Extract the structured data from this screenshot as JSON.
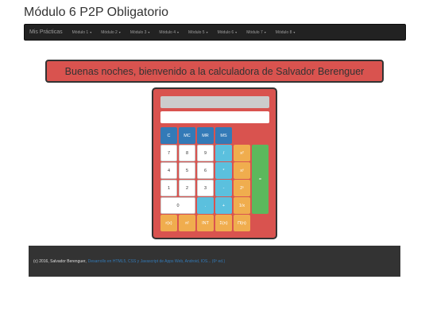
{
  "page": {
    "title": "Módulo 6 P2P Obligatorio"
  },
  "navbar": {
    "brand": "Mis Prácticas",
    "items": [
      {
        "label": "Módulo 1"
      },
      {
        "label": "Módulo 2"
      },
      {
        "label": "Módulo 3"
      },
      {
        "label": "Módulo 4"
      },
      {
        "label": "Módulo 5"
      },
      {
        "label": "Módulo 6"
      },
      {
        "label": "Módulo 7"
      },
      {
        "label": "Módulo 8"
      }
    ],
    "caret": "▾"
  },
  "welcome": {
    "text": "Buenas noches, bienvenido a la calculadora de Salvador Berenguer"
  },
  "calculator": {
    "display_top": "",
    "display_main": "",
    "buttons": {
      "c": "C",
      "mc": "MC",
      "mr": "MR",
      "ms": "MS",
      "n7": "7",
      "n8": "8",
      "n9": "9",
      "divide": "/",
      "square": "x²",
      "n4": "4",
      "n5": "5",
      "n6": "6",
      "multiply": "*",
      "power": "xʸ",
      "n1": "1",
      "n2": "2",
      "n3": "3",
      "minus": "-",
      "pow2": "2ˣ",
      "n0": "0",
      "dot": ".",
      "plus": "+",
      "inverse": "1/x",
      "equals": "=",
      "factorial": "n!",
      "r_fn": "r(x)",
      "int_fn": "INT",
      "sum_fn": "Σ(n)",
      "prod_fn": "Π(n)"
    }
  },
  "footer": {
    "text": "(c) 2016, Salvador Berenguer,",
    "link": "Desarrollo en HTML5, CSS y Javascript de Apps Web, Android, IOS... (6ª ed.)"
  },
  "colors": {
    "navbar_bg": "#222222",
    "welcome_bg": "#d9534f",
    "calc_bg": "#d9534f",
    "primary_blue": "#337ab7",
    "info_cyan": "#5bc0de",
    "warning_orange": "#f0ad4e",
    "success_green": "#5cb85c",
    "footer_bg": "#333333"
  }
}
